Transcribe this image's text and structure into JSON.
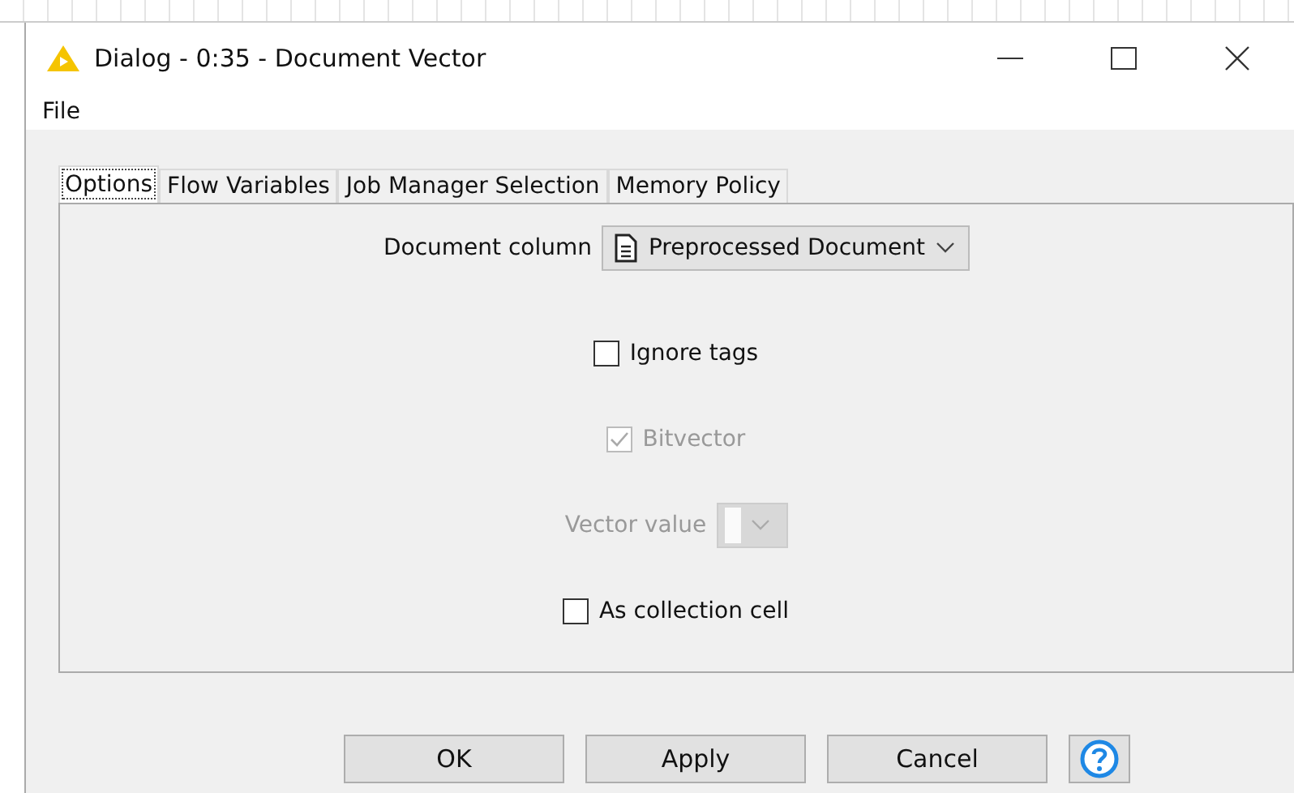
{
  "window": {
    "title": "Dialog - 0:35 - Document Vector"
  },
  "menu": [
    "File"
  ],
  "tabs": [
    {
      "label": "Options",
      "selected": true
    },
    {
      "label": "Flow Variables",
      "selected": false
    },
    {
      "label": "Job Manager Selection",
      "selected": false
    },
    {
      "label": "Memory Policy",
      "selected": false
    }
  ],
  "fields": [
    {
      "kind": "dropdown",
      "label": "Document column",
      "value": "Preprocessed Document",
      "disabled": false
    },
    {
      "kind": "checkbox",
      "label": "Ignore tags",
      "checked": false,
      "disabled": false
    },
    {
      "kind": "checkbox",
      "label": "Bitvector",
      "checked": true,
      "disabled": true
    },
    {
      "kind": "dropdown",
      "label": "Vector value",
      "disabled": true
    },
    {
      "kind": "checkbox",
      "label": "As collection cell",
      "checked": false,
      "disabled": false
    }
  ],
  "buttons": [
    "OK",
    "Apply",
    "Cancel"
  ]
}
